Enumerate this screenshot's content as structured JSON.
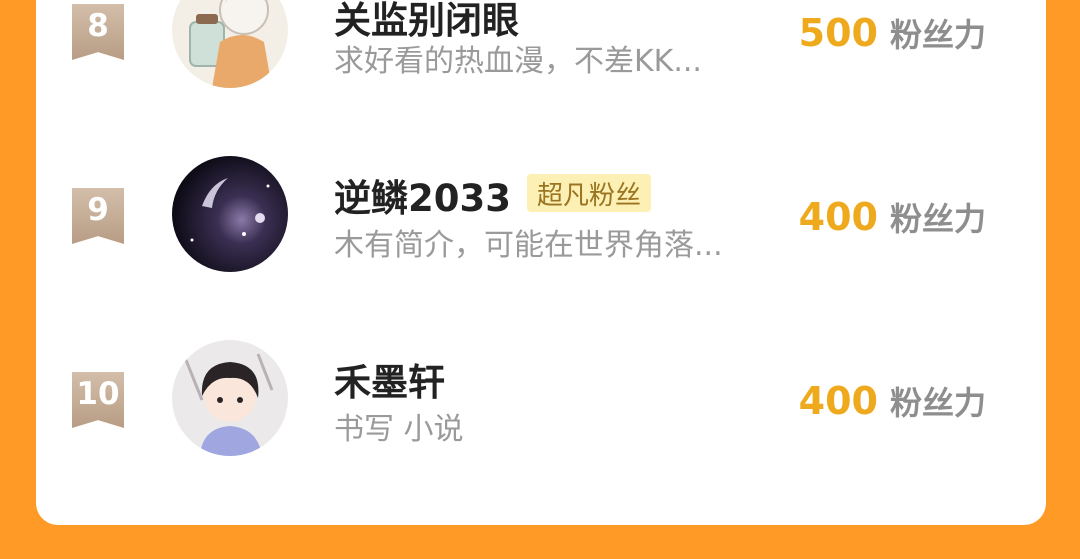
{
  "ranking": [
    {
      "rank": "8",
      "name": "关监别闭眼",
      "badge": "",
      "desc": "求好看的热血漫，不差KK...",
      "score": "500",
      "score_unit": "粉丝力",
      "avatar": "anime-boy-avatar"
    },
    {
      "rank": "9",
      "name": "逆鳞2033",
      "badge": "超凡粉丝",
      "desc": "木有简介，可能在世界角落...",
      "score": "400",
      "score_unit": "粉丝力",
      "avatar": "galaxy-avatar"
    },
    {
      "rank": "10",
      "name": "禾墨轩",
      "badge": "",
      "desc": "书写 小说",
      "score": "400",
      "score_unit": "粉丝力",
      "avatar": "chibi-boy-avatar"
    }
  ],
  "colors": {
    "background": "#ff9a26",
    "score": "#efa91d",
    "badge_bg": "#fdf0b4",
    "rank_flag": "#c9b29c"
  }
}
